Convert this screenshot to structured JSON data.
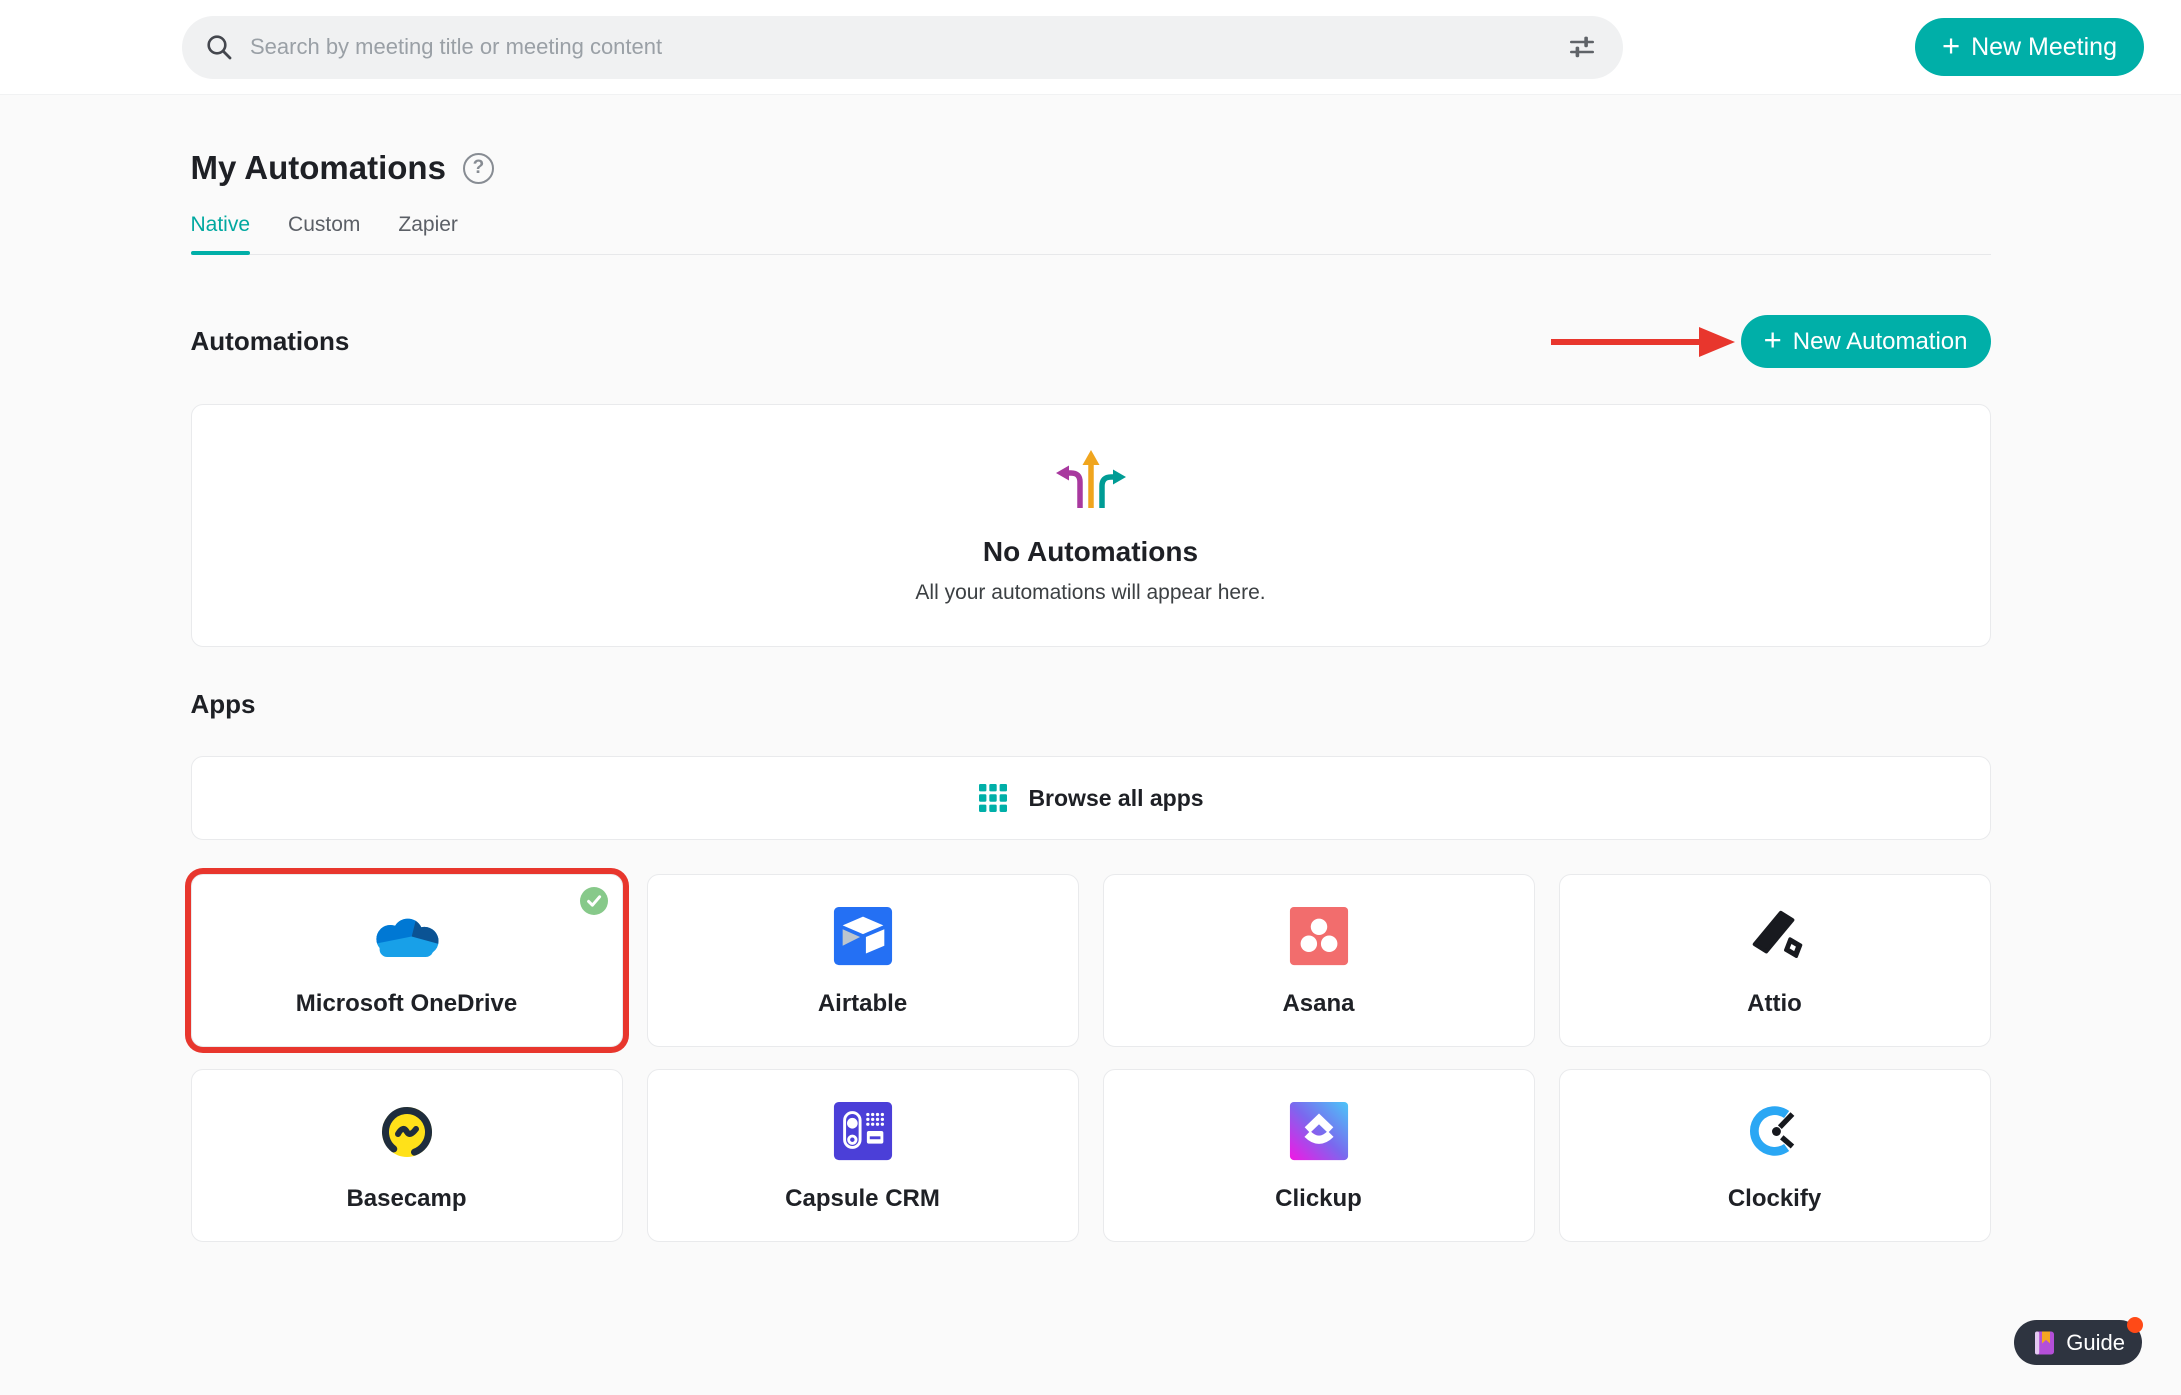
{
  "colors": {
    "accent_teal": "#00AFA8",
    "annotation_red": "#E8362D",
    "connected_green": "#87C98A",
    "guide_pill_bg": "#2E3440",
    "notification_dot": "#FF4A17",
    "page_background": "#FAFAFA"
  },
  "icons": {
    "help_glyph": "?",
    "plus_glyph": "+"
  },
  "topbar": {
    "search_placeholder": "Search by meeting title or meeting content",
    "new_meeting_label": "New Meeting"
  },
  "page": {
    "title": "My Automations"
  },
  "tabs": [
    {
      "label": "Native",
      "active": true
    },
    {
      "label": "Custom",
      "active": false
    },
    {
      "label": "Zapier",
      "active": false
    }
  ],
  "automations": {
    "heading": "Automations",
    "new_automation_label": "New Automation",
    "empty_title": "No Automations",
    "empty_subtitle": "All your automations will appear here."
  },
  "apps": {
    "heading": "Apps",
    "browse_all_label": "Browse all apps",
    "cards": [
      {
        "name": "Microsoft OneDrive",
        "icon": "onedrive-logo",
        "highlighted": true,
        "connected": true
      },
      {
        "name": "Airtable",
        "icon": "airtable-logo",
        "highlighted": false,
        "connected": false
      },
      {
        "name": "Asana",
        "icon": "asana-logo",
        "highlighted": false,
        "connected": false
      },
      {
        "name": "Attio",
        "icon": "attio-logo",
        "highlighted": false,
        "connected": false
      },
      {
        "name": "Basecamp",
        "icon": "basecamp-logo",
        "highlighted": false,
        "connected": false
      },
      {
        "name": "Capsule CRM",
        "icon": "capsule-crm-logo",
        "highlighted": false,
        "connected": false
      },
      {
        "name": "Clickup",
        "icon": "clickup-logo",
        "highlighted": false,
        "connected": false
      },
      {
        "name": "Clockify",
        "icon": "clockify-logo",
        "highlighted": false,
        "connected": false
      }
    ]
  },
  "guide": {
    "label": "Guide",
    "has_notification": true
  }
}
